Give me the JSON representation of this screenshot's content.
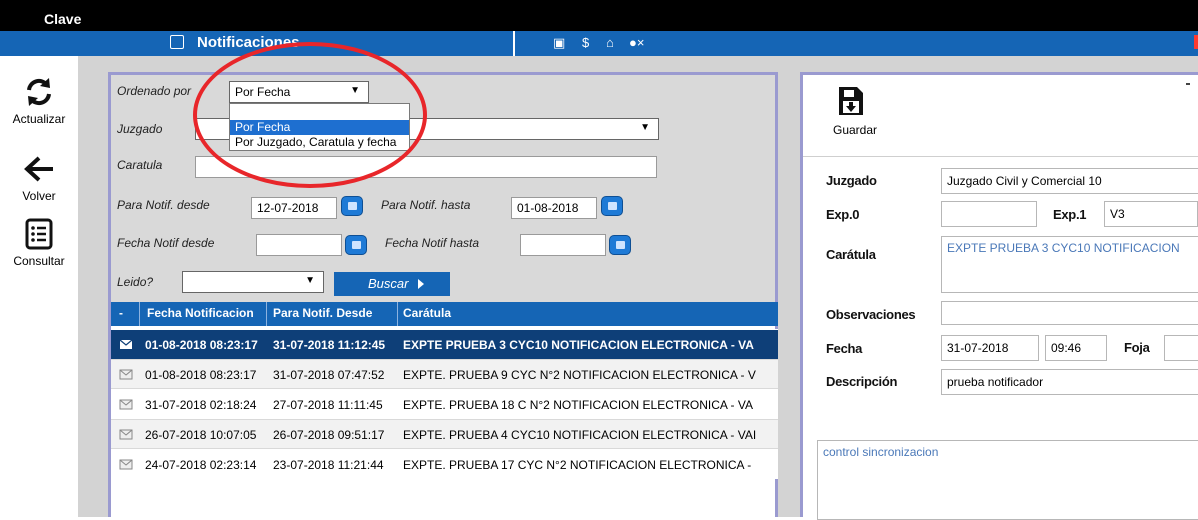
{
  "topbar": {
    "title": "Clave"
  },
  "titlebar": {
    "title": "Notificaciones",
    "icons": [
      "document-icon",
      "dollar-icon",
      "home-icon",
      "user-remove-icon"
    ]
  },
  "nav": [
    {
      "label": "Actualizar",
      "icon": "refresh-icon"
    },
    {
      "label": "Volver",
      "icon": "back-arrow-icon"
    },
    {
      "label": "Consultar",
      "icon": "list-icon"
    }
  ],
  "filters": {
    "ordenado_label": "Ordenado por",
    "ordenado_value": "Por Fecha",
    "ordenado_options": [
      "Por Fecha",
      "Por Juzgado, Caratula y fecha"
    ],
    "juzgado_label": "Juzgado",
    "juzgado_value": "",
    "caratula_label": "Caratula",
    "caratula_value": "",
    "para_desde_label": "Para Notif. desde",
    "para_desde_value": "12-07-2018",
    "para_hasta_label": "Para Notif. hasta",
    "para_hasta_value": "01-08-2018",
    "fecha_desde_label": "Fecha Notif desde",
    "fecha_desde_value": "",
    "fecha_hasta_label": "Fecha Notif hasta",
    "fecha_hasta_value": "",
    "leido_label": "Leido?",
    "leido_value": "",
    "buscar_label": "Buscar"
  },
  "grid": {
    "columns": [
      "-",
      "Fecha Notificacion",
      "Para Notif. Desde",
      "Carátula"
    ],
    "rows": [
      {
        "fecha": "01-08-2018 08:23:17",
        "desde": "31-07-2018 11:12:45",
        "caratula": "EXPTE PRUEBA 3 CYC10 NOTIFICACION ELECTRONICA - VA"
      },
      {
        "fecha": "01-08-2018 08:23:17",
        "desde": "31-07-2018 07:47:52",
        "caratula": "EXPTE. PRUEBA 9 CYC N°2 NOTIFICACION ELECTRONICA - V"
      },
      {
        "fecha": "31-07-2018 02:18:24",
        "desde": "27-07-2018 11:11:45",
        "caratula": "EXPTE. PRUEBA 18 C N°2 NOTIFICACION ELECTRONICA - VA"
      },
      {
        "fecha": "26-07-2018 10:07:05",
        "desde": "26-07-2018 09:51:17",
        "caratula": "EXPTE. PRUEBA 4 CYC10 NOTIFICACION ELECTRONICA - VAI"
      },
      {
        "fecha": "24-07-2018 02:23:14",
        "desde": "23-07-2018 11:21:44",
        "caratula": "EXPTE. PRUEBA 17 CYC N°2 NOTIFICACION ELECTRONICA -"
      }
    ]
  },
  "detail": {
    "guardar_label": "Guardar",
    "juzgado_label": "Juzgado",
    "juzgado_value": "Juzgado Civil y Comercial 10",
    "exp0_label": "Exp.0",
    "exp0_value": "",
    "exp1_label": "Exp.1",
    "exp1_value": "V3",
    "caratula_label": "Carátula",
    "caratula_value": "EXPTE PRUEBA 3 CYC10 NOTIFICACION",
    "observaciones_label": "Observaciones",
    "observaciones_value": "",
    "fecha_label": "Fecha",
    "fecha_value": "31-07-2018",
    "hora_value": "09:46",
    "foja_label": "Foja",
    "foja_value": "",
    "descripcion_label": "Descripción",
    "descripcion_value": "prueba notificador",
    "notes_value": "control sincronizacion"
  },
  "colors": {
    "accent_blue": "#1565b5",
    "selected_row": "#0e3f78",
    "highlight_circle": "#e8262a",
    "panel_border": "#9a9ad0"
  }
}
